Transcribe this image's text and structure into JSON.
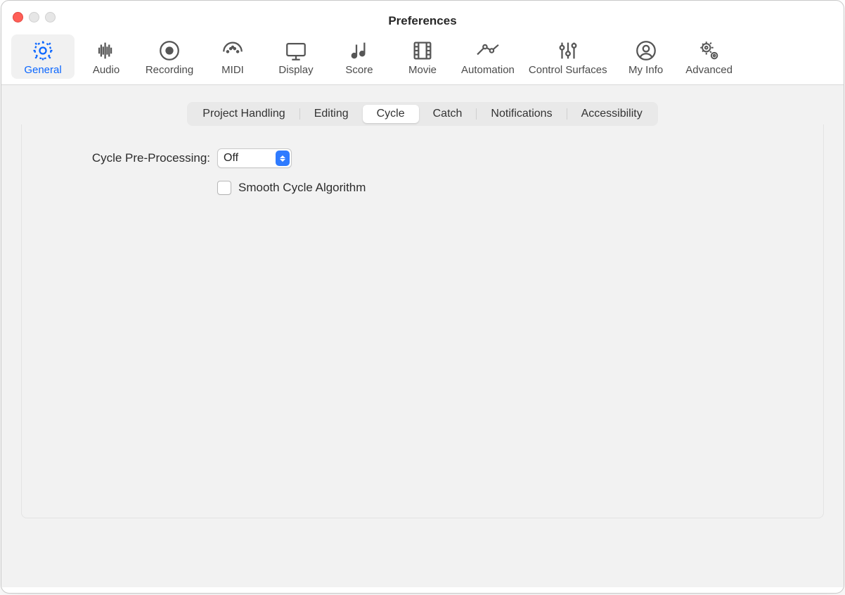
{
  "window": {
    "title": "Preferences"
  },
  "toolbar": {
    "items": [
      {
        "label": "General"
      },
      {
        "label": "Audio"
      },
      {
        "label": "Recording"
      },
      {
        "label": "MIDI"
      },
      {
        "label": "Display"
      },
      {
        "label": "Score"
      },
      {
        "label": "Movie"
      },
      {
        "label": "Automation"
      },
      {
        "label": "Control Surfaces"
      },
      {
        "label": "My Info"
      },
      {
        "label": "Advanced"
      }
    ],
    "active_index": 0
  },
  "subtabs": {
    "items": [
      "Project Handling",
      "Editing",
      "Cycle",
      "Catch",
      "Notifications",
      "Accessibility"
    ],
    "active_index": 2
  },
  "form": {
    "cycle_preprocessing_label": "Cycle Pre-Processing:",
    "cycle_preprocessing_value": "Off",
    "smooth_cycle_label": "Smooth Cycle Algorithm",
    "smooth_cycle_checked": false
  }
}
